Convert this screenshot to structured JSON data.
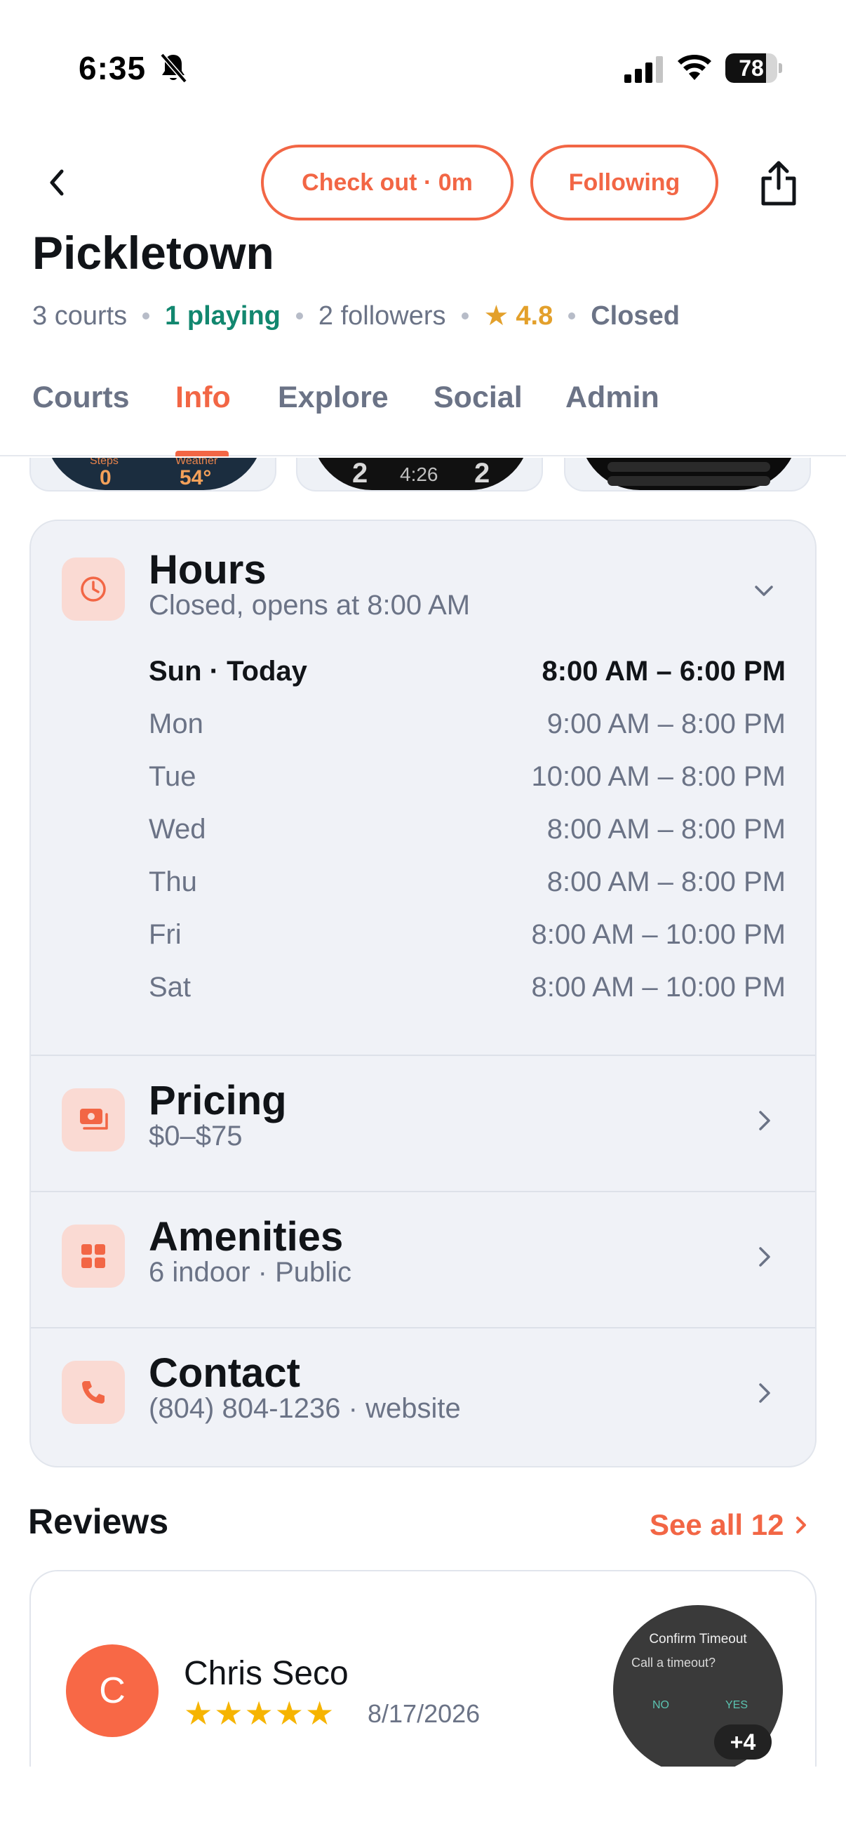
{
  "status_bar": {
    "time": "6:35",
    "battery": "78",
    "battery_level": 0.78
  },
  "header": {
    "back_icon": "chevron-left-icon",
    "checkout_label": "Check out · 0m",
    "following_label": "Following",
    "share_icon": "share-icon"
  },
  "venue": {
    "title": "Pickletown",
    "courts": "3 courts",
    "playing": "1 playing",
    "followers": "2 followers",
    "rating": "4.8",
    "status": "Closed"
  },
  "tabs": [
    {
      "label": "Courts"
    },
    {
      "label": "Info"
    },
    {
      "label": "Explore"
    },
    {
      "label": "Social"
    },
    {
      "label": "Admin"
    }
  ],
  "active_tab": "Info",
  "carousel": {
    "card1": {
      "steps_label": "Steps",
      "steps_value": "0",
      "weather_label": "Weather",
      "weather_value": "54°"
    },
    "card2": {
      "score_left": "2",
      "clock": "4:26",
      "score_right": "2"
    }
  },
  "info": {
    "hours": {
      "title": "Hours",
      "subtitle": "Closed, opens at 8:00 AM",
      "days": [
        {
          "day": "Sun · Today",
          "time": "8:00 AM – 6:00 PM"
        },
        {
          "day": "Mon",
          "time": "9:00 AM – 8:00 PM"
        },
        {
          "day": "Tue",
          "time": "10:00 AM – 8:00 PM"
        },
        {
          "day": "Wed",
          "time": "8:00 AM – 8:00 PM"
        },
        {
          "day": "Thu",
          "time": "8:00 AM – 8:00 PM"
        },
        {
          "day": "Fri",
          "time": "8:00 AM – 10:00 PM"
        },
        {
          "day": "Sat",
          "time": "8:00 AM – 10:00 PM"
        }
      ]
    },
    "pricing": {
      "title": "Pricing",
      "subtitle": "$0–$75"
    },
    "amenities": {
      "title": "Amenities",
      "subtitle": "6 indoor · Public"
    },
    "contact": {
      "title": "Contact",
      "subtitle": "(804) 804-1236 · website"
    }
  },
  "reviews": {
    "title": "Reviews",
    "see_all": "See all 12",
    "items": [
      {
        "avatar_letter": "C",
        "name": "Chris Seco",
        "rating": 5,
        "date": "8/17/2026",
        "thumb_title": "Confirm Timeout",
        "thumb_question": "Call a timeout?",
        "thumb_no": "NO",
        "thumb_yes": "YES",
        "more_photos": "+4"
      }
    ]
  },
  "colors": {
    "accent": "#f26645",
    "playing": "#12876f",
    "rating": "#e3a02b",
    "card_bg": "#f0f2f7",
    "icon_bg": "#fadad3"
  }
}
